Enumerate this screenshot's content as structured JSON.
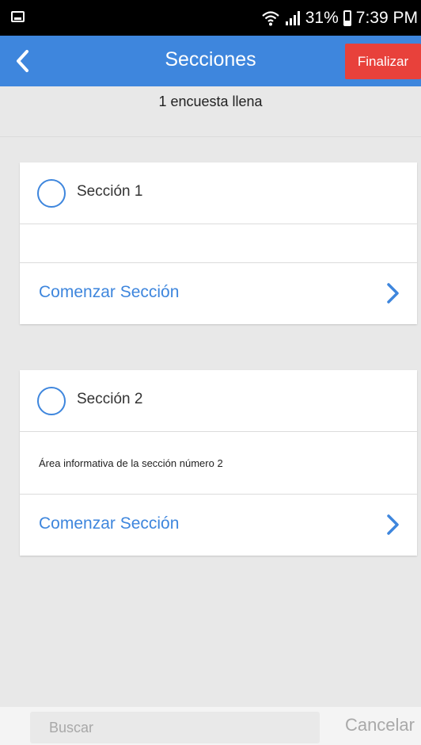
{
  "status_bar": {
    "battery": "31%",
    "battery_level": 0.31,
    "time": "7:39 PM",
    "icons": [
      "screenshot-icon",
      "wifi-icon",
      "signal-icon",
      "battery-icon"
    ]
  },
  "header": {
    "title": "Secciones",
    "finalize_label": "Finalizar",
    "colors": {
      "bar": "#3e86dd",
      "finalize": "#e8413b"
    }
  },
  "subheader": {
    "text": "1 encuesta llena"
  },
  "sections": [
    {
      "title": "Sección 1",
      "info": "",
      "action_label": "Comenzar Sección"
    },
    {
      "title": "Sección 2",
      "info": "Área informativa de la sección número 2",
      "action_label": "Comenzar Sección"
    }
  ],
  "search": {
    "placeholder": "Buscar",
    "value": "",
    "cancel_label": "Cancelar"
  }
}
